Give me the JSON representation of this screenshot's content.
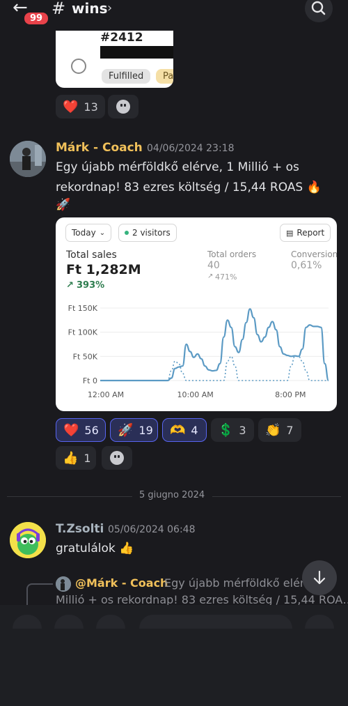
{
  "header": {
    "unread_badge": "99",
    "channel_hash": "#",
    "channel_name": "wins",
    "chevron": "›"
  },
  "order_card": {
    "order_number": "#2412",
    "status_fulfilled": "Fulfilled",
    "status_partial": "Pa"
  },
  "reactions_top": [
    {
      "emoji": "❤️",
      "count": "13"
    }
  ],
  "message1": {
    "author": "Márk - Coach",
    "timestamp": "04/06/2024 23:18",
    "line1": "Egy újabb mérföldkő elérve, 1 Millió + os",
    "line2": "rekordnap! 83 ezres költség / 15,44 ROAS 🔥",
    "line3": "🚀",
    "author_color": "#f0c05a"
  },
  "sales_card": {
    "date_filter": "Today",
    "visitors": "2 visitors",
    "report_button": "Report",
    "total_sales_label": "Total sales",
    "total_sales_value": "Ft 1,282M",
    "total_sales_change": "393%",
    "total_orders_label": "Total orders",
    "total_orders_value": "40",
    "total_orders_change": "471%",
    "conversion_label": "Conversion",
    "conversion_value": "0,61%"
  },
  "chart_data": {
    "type": "line",
    "y_ticks": [
      "Ft 150K",
      "Ft 100K",
      "Ft 50K",
      "Ft 0"
    ],
    "x_ticks": [
      "12:00 AM",
      "10:00 AM",
      "8:00 PM"
    ],
    "ylim": [
      0,
      150000
    ],
    "series": [
      {
        "style": "solid",
        "color": "#5b9ac4",
        "points": [
          [
            0,
            0
          ],
          [
            1,
            0
          ],
          [
            2,
            0
          ],
          [
            3,
            0
          ],
          [
            4,
            0
          ],
          [
            5,
            0
          ],
          [
            6,
            0
          ],
          [
            7,
            0
          ],
          [
            8,
            0
          ],
          [
            9,
            0
          ],
          [
            10,
            0
          ],
          [
            11,
            0
          ],
          [
            12,
            0
          ],
          [
            13,
            0
          ],
          [
            14,
            0
          ],
          [
            15,
            0
          ],
          [
            16,
            0
          ],
          [
            17,
            0
          ],
          [
            18,
            0
          ],
          [
            19,
            5000
          ],
          [
            20,
            25000
          ],
          [
            21,
            28000
          ],
          [
            22,
            30000
          ],
          [
            23,
            75000
          ],
          [
            24,
            60000
          ],
          [
            25,
            48000
          ],
          [
            26,
            55000
          ],
          [
            27,
            45000
          ],
          [
            28,
            30000
          ],
          [
            29,
            22000
          ],
          [
            30,
            20000
          ],
          [
            31,
            21000
          ],
          [
            32,
            35000
          ],
          [
            33,
            90000
          ],
          [
            34,
            125000
          ],
          [
            35,
            110000
          ],
          [
            36,
            70000
          ],
          [
            37,
            58000
          ],
          [
            38,
            85000
          ],
          [
            39,
            120000
          ],
          [
            40,
            148000
          ],
          [
            41,
            130000
          ],
          [
            42,
            95000
          ],
          [
            43,
            80000
          ],
          [
            44,
            90000
          ],
          [
            45,
            110000
          ],
          [
            46,
            122000
          ],
          [
            47,
            105000
          ],
          [
            48,
            70000
          ],
          [
            49,
            55000
          ],
          [
            50,
            52000
          ],
          [
            51,
            50000
          ],
          [
            52,
            51000
          ],
          [
            53,
            50000
          ],
          [
            54,
            65000
          ],
          [
            55,
            110000
          ],
          [
            56,
            115000
          ],
          [
            57,
            112000
          ],
          [
            58,
            112000
          ],
          [
            59,
            110000
          ],
          [
            60,
            35000
          ],
          [
            61,
            0
          ]
        ]
      },
      {
        "style": "dotted",
        "color": "#5b9ac4",
        "points": [
          [
            0,
            0
          ],
          [
            18,
            0
          ],
          [
            19,
            20000
          ],
          [
            20,
            40000
          ],
          [
            21,
            35000
          ],
          [
            22,
            15000
          ],
          [
            23,
            0
          ],
          [
            24,
            0
          ],
          [
            33,
            0
          ],
          [
            34,
            40000
          ],
          [
            35,
            50000
          ],
          [
            36,
            30000
          ],
          [
            37,
            0
          ],
          [
            50,
            0
          ],
          [
            51,
            30000
          ],
          [
            52,
            50000
          ],
          [
            53,
            50000
          ],
          [
            54,
            40000
          ],
          [
            55,
            20000
          ],
          [
            56,
            0
          ],
          [
            61,
            0
          ]
        ]
      }
    ],
    "grid": true
  },
  "reactions_main": [
    {
      "emoji": "❤️",
      "count": "56",
      "active": true
    },
    {
      "emoji": "🚀",
      "count": "19",
      "active": true
    },
    {
      "emoji": "🫶",
      "count": "4",
      "active": true
    },
    {
      "emoji": "💲",
      "count": "3",
      "active": false
    },
    {
      "emoji": "👏",
      "count": "7",
      "active": false
    },
    {
      "emoji": "👍",
      "count": "1",
      "active": false
    }
  ],
  "date_divider": "5 giugno 2024",
  "message2": {
    "author": "T.Zsolti",
    "timestamp": "05/06/2024 06:48",
    "text": "gratulálok 👍",
    "author_color": "#a8b3bd"
  },
  "reply_preview": {
    "mention": "@Márk - Coach",
    "line1": "Egy újabb mérföldkő elérve,",
    "line2": "Millió + os rekordnap! 83 ezres költség / 15,44 ROA…"
  }
}
